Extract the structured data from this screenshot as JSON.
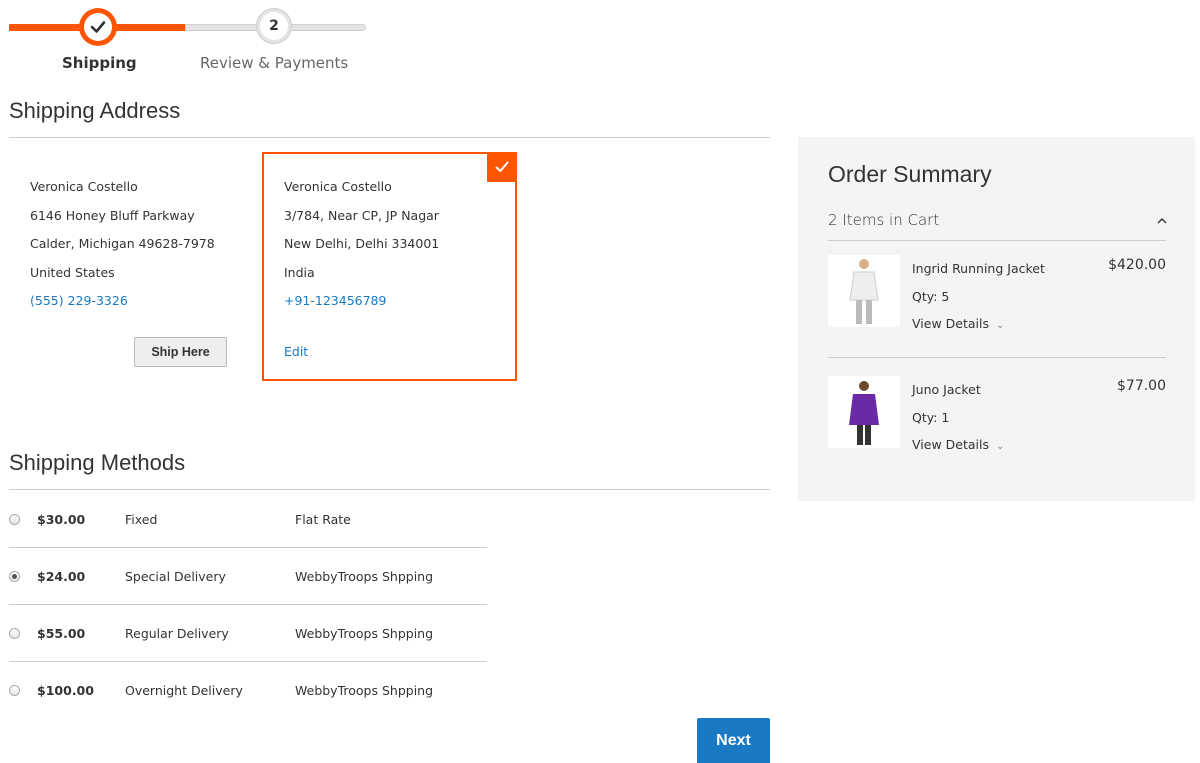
{
  "progress": {
    "step1_label": "Shipping",
    "step2_number": "2",
    "step2_label": "Review & Payments"
  },
  "shipping_address": {
    "title": "Shipping Address",
    "addresses": [
      {
        "name": "Veronica Costello",
        "street": "6146 Honey Bluff Parkway",
        "city_line": "Calder, Michigan 49628-7978",
        "country": "United States",
        "phone": "(555) 229-3326",
        "action_label": "Ship Here"
      },
      {
        "name": "Veronica Costello",
        "street": "3/784, Near CP, JP Nagar",
        "city_line": "New Delhi, Delhi 334001",
        "country": "India",
        "phone": "+91-123456789",
        "action_label": "Edit",
        "selected": true
      }
    ]
  },
  "shipping_methods": {
    "title": "Shipping Methods",
    "rows": [
      {
        "price": "$30.00",
        "method": "Fixed",
        "carrier": "Flat Rate",
        "selected": false
      },
      {
        "price": "$24.00",
        "method": "Special Delivery",
        "carrier": "WebbyTroops Shpping",
        "selected": true
      },
      {
        "price": "$55.00",
        "method": "Regular Delivery",
        "carrier": "WebbyTroops Shpping",
        "selected": false
      },
      {
        "price": "$100.00",
        "method": "Overnight Delivery",
        "carrier": "WebbyTroops Shpping",
        "selected": false
      }
    ]
  },
  "next_label": "Next",
  "order_summary": {
    "title": "Order Summary",
    "cart_count": "2 Items in Cart",
    "items": [
      {
        "name": "Ingrid Running Jacket",
        "qty": "Qty: 5",
        "price": "$420.00",
        "details_label": "View Details",
        "color": "#e8e8e8"
      },
      {
        "name": "Juno Jacket",
        "qty": "Qty: 1",
        "price": "$77.00",
        "details_label": "View Details",
        "color": "#6a2aa8"
      }
    ]
  },
  "colors": {
    "accent": "#ff5501",
    "link": "#1979c3",
    "primary_button": "#1979c3"
  }
}
